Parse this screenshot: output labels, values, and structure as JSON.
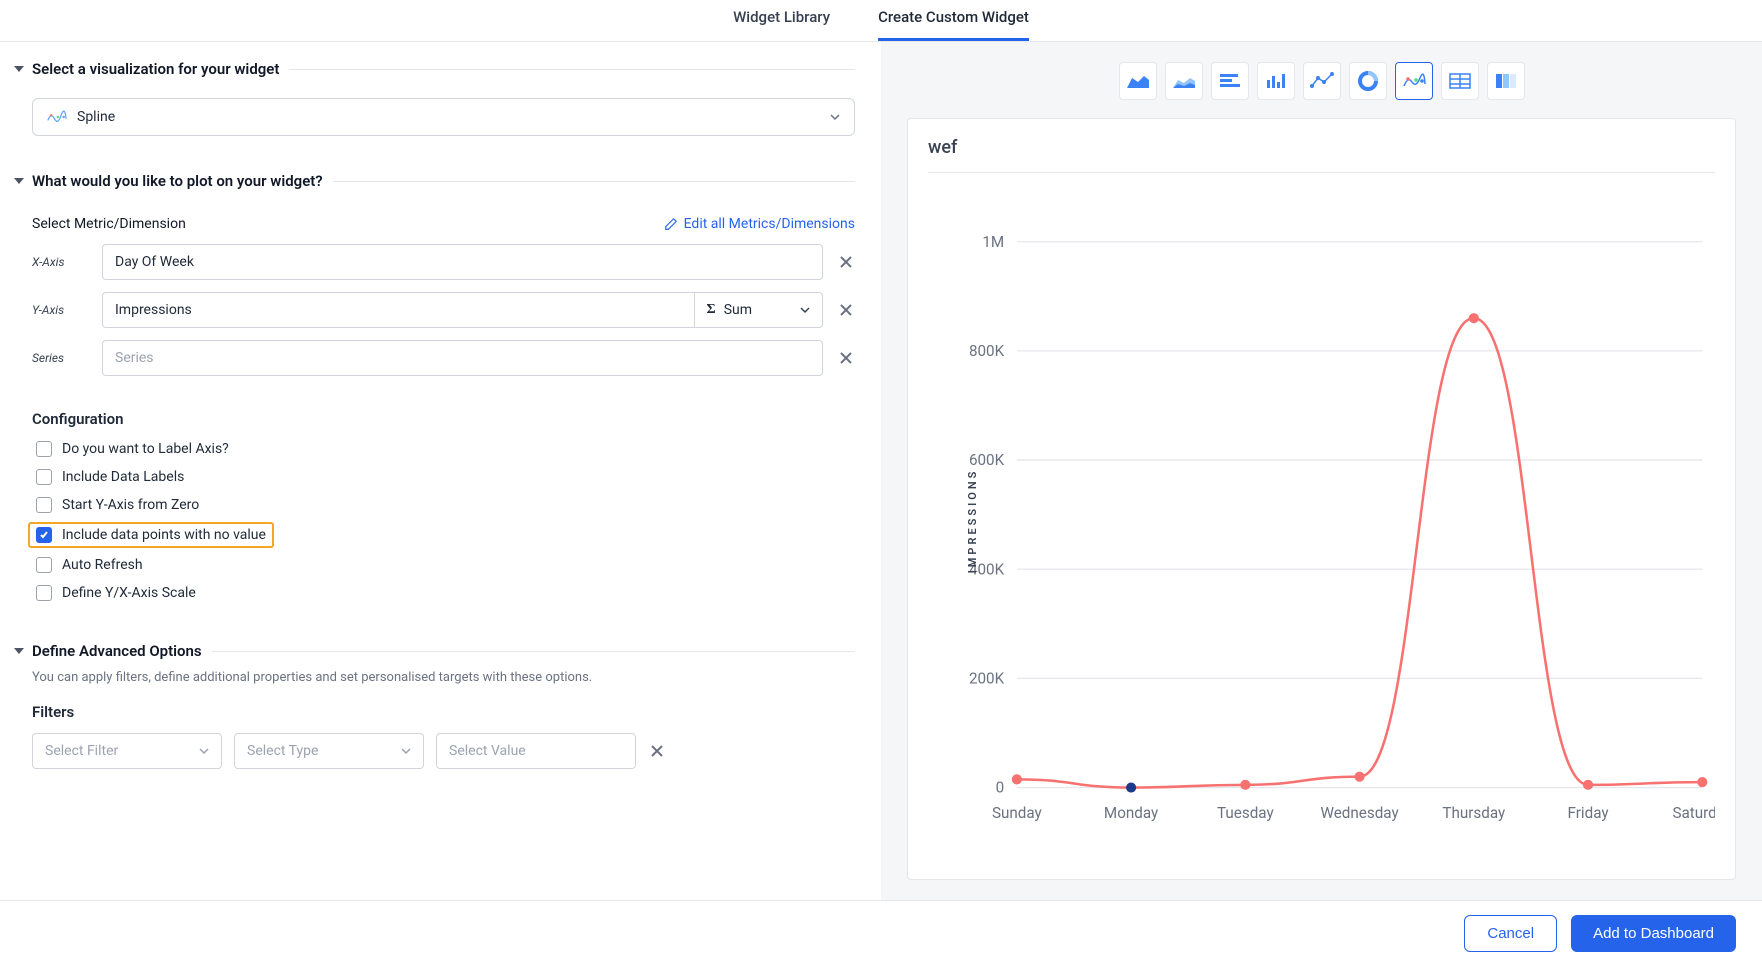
{
  "tabs": {
    "library": "Widget Library",
    "create": "Create Custom Widget"
  },
  "viz": {
    "header": "Select a visualization for your widget",
    "selected": "Spline"
  },
  "plot": {
    "header": "What would you like to plot on your widget?",
    "metric_label": "Select Metric/Dimension",
    "edit_link": "Edit all Metrics/Dimensions",
    "x_label": "X-Axis",
    "x_value": "Day Of Week",
    "y_label": "Y-Axis",
    "y_value": "Impressions",
    "agg": "Sum",
    "series_label": "Series",
    "series_placeholder": "Series"
  },
  "config": {
    "title": "Configuration",
    "opts": [
      {
        "label": "Do you want to Label Axis?",
        "checked": false
      },
      {
        "label": "Include Data Labels",
        "checked": false
      },
      {
        "label": "Start Y-Axis from Zero",
        "checked": false
      },
      {
        "label": "Include data points with no value",
        "checked": true,
        "hl": true
      },
      {
        "label": "Auto Refresh",
        "checked": false
      },
      {
        "label": "Define Y/X-Axis Scale",
        "checked": false
      }
    ]
  },
  "adv": {
    "header": "Define Advanced Options",
    "sub": "You can apply filters, define additional properties and set personalised targets with these options."
  },
  "filters": {
    "title": "Filters",
    "f1": "Select Filter",
    "f2": "Select Type",
    "f3": "Select Value"
  },
  "chart_types": [
    "area",
    "area-stacked",
    "bar-horizontal",
    "bar-vertical",
    "scatter",
    "donut",
    "spline",
    "table",
    "heatmap"
  ],
  "chart_active": "spline",
  "chart_title": "wef",
  "chart_data": {
    "type": "line",
    "title": "wef",
    "xlabel": "",
    "ylabel": "IMPRESSIONS",
    "categories": [
      "Sunday",
      "Monday",
      "Tuesday",
      "Wednesday",
      "Thursday",
      "Friday",
      "Saturday"
    ],
    "values": [
      15000,
      0,
      5000,
      20000,
      860000,
      5000,
      10000
    ],
    "ylim": [
      0,
      1000000
    ],
    "yticks": [
      "0",
      "200K",
      "400K",
      "600K",
      "800K",
      "1M"
    ]
  },
  "footer": {
    "cancel": "Cancel",
    "add": "Add to Dashboard"
  }
}
